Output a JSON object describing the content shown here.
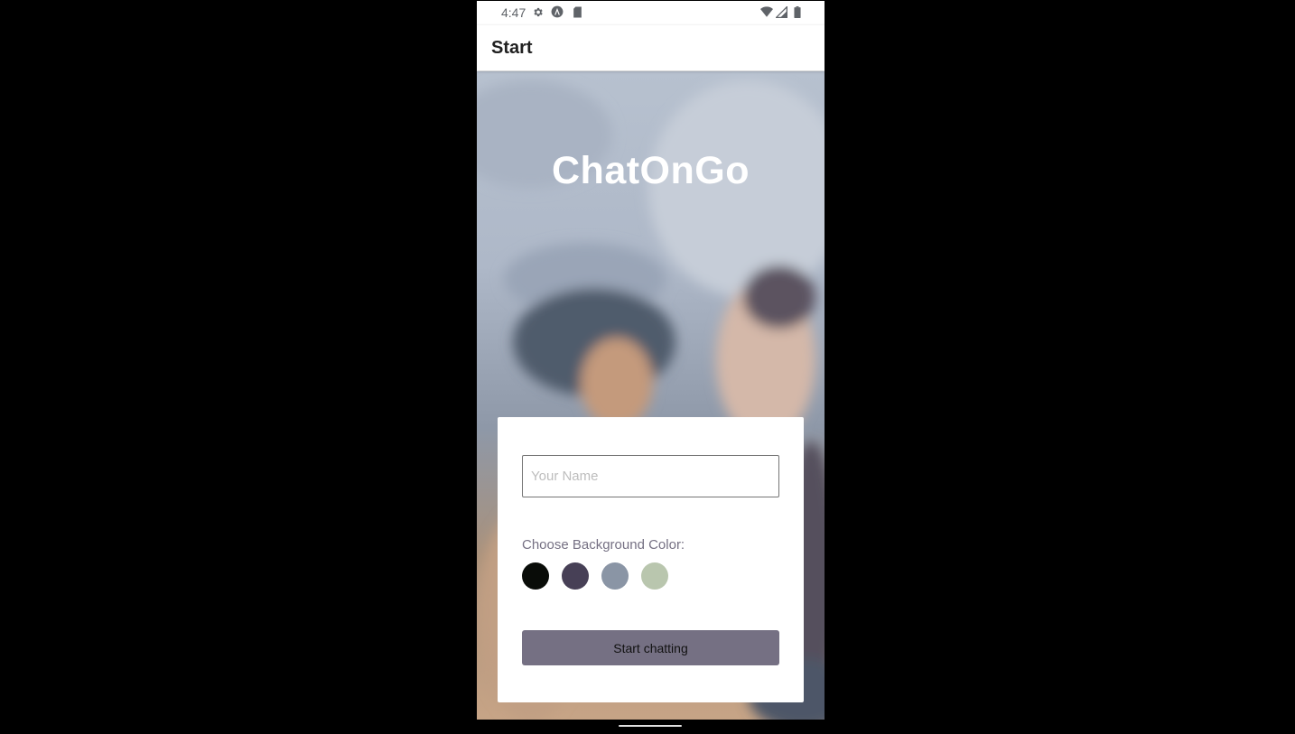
{
  "status_bar": {
    "time": "4:47",
    "icons": [
      "gear-icon",
      "android-logo-icon",
      "sd-card-icon",
      "wifi-icon",
      "cell-signal-icon",
      "battery-icon"
    ]
  },
  "app_bar": {
    "title": "Start"
  },
  "hero": {
    "title": "ChatOnGo"
  },
  "form": {
    "name_placeholder": "Your Name",
    "name_value": "",
    "color_label": "Choose Background Color:",
    "swatches": [
      {
        "name": "black",
        "color": "#090C08"
      },
      {
        "name": "purple",
        "color": "#474056"
      },
      {
        "name": "gray-blue",
        "color": "#8A95A5"
      },
      {
        "name": "green",
        "color": "#B9C6AE"
      }
    ],
    "start_button_label": "Start chatting",
    "button_color": "#757083"
  },
  "colors": {
    "app_bar_bg": "#ffffff",
    "page_bg": "#000000",
    "title_text": "#ffffff"
  }
}
